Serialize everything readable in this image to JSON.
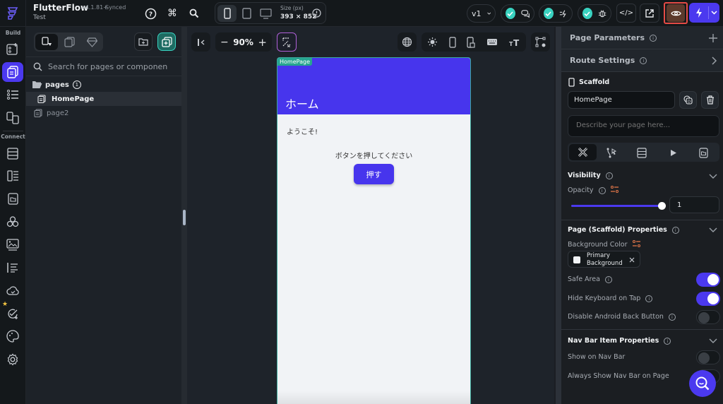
{
  "app": {
    "name": "FlutterFlow",
    "version": "v4.1.81+",
    "sync_status": "Synced",
    "project": "Test"
  },
  "topbar": {
    "size_label": "Size (px)",
    "size_value": "393 × 852",
    "version_select": "v1",
    "icons": [
      "help-icon",
      "command-icon",
      "search-icon"
    ],
    "status_checks": [
      "comments",
      "actions",
      "debug"
    ]
  },
  "colors": {
    "accent": "#4b39ef",
    "teal": "#39d2c0",
    "preview_highlight": "#e64b45",
    "appbar": "#4735ed"
  },
  "pages_panel": {
    "search_placeholder": "Search for pages or componen...",
    "folder": {
      "label": "pages",
      "count": "1"
    },
    "items": [
      {
        "label": "HomePage",
        "selected": true
      },
      {
        "label": "page2",
        "selected": false
      }
    ]
  },
  "rail": {
    "build_label": "Build",
    "connect_label": "Connect"
  },
  "canvas": {
    "zoom": "90%",
    "zoom_minus": "−",
    "zoom_plus": "+",
    "phone": {
      "page_tag": "HomePage",
      "appbar_title": "ホーム",
      "welcome_text": "ようこそ!",
      "prompt_text": "ボタンを押してください",
      "button_label": "押す"
    }
  },
  "properties": {
    "page_parameters": "Page Parameters",
    "route_settings": "Route Settings",
    "scaffold_label": "Scaffold",
    "page_name": "HomePage",
    "description_placeholder": "Describe your page here...",
    "visibility": {
      "title": "Visibility",
      "opacity_label": "Opacity",
      "opacity_value": "1",
      "opacity_fraction": 1.0
    },
    "scaffold_props": {
      "title": "Page (Scaffold) Properties",
      "bg_color_label": "Background Color",
      "bg_color_value_line1": "Primary",
      "bg_color_value_line2": "Background",
      "toggles": [
        {
          "label": "Safe Area",
          "on": true,
          "info": true
        },
        {
          "label": "Hide Keyboard on Tap",
          "on": true,
          "info": true
        },
        {
          "label": "Disable Android Back Button",
          "on": false,
          "info": true
        }
      ]
    },
    "navbar_props": {
      "title": "Nav Bar Item Properties",
      "toggles": [
        {
          "label": "Show on Nav Bar",
          "on": false
        },
        {
          "label": "Always Show Nav Bar on Page",
          "on": false
        }
      ]
    }
  }
}
